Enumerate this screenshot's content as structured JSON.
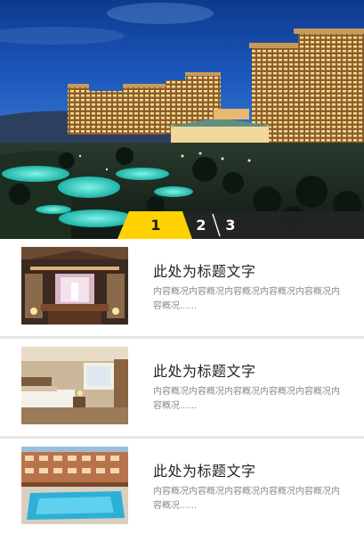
{
  "banner": {
    "slides": [
      "1",
      "2",
      "3"
    ],
    "active_slide": 1,
    "accent_color": "#ffd200"
  },
  "items": [
    {
      "title": "此处为标题文字",
      "description": "内容概况内容概况内容概况内容概况内容概况内容概况......",
      "thumbnail": "hotel-lounge-image"
    },
    {
      "title": "此处为标题文字",
      "description": "内容概况内容概况内容概况内容概况内容概况内容概况......",
      "thumbnail": "hotel-bedroom-image"
    },
    {
      "title": "此处为标题文字",
      "description": "内容概况内容概况内容概况内容概况内容概况内容概况......",
      "thumbnail": "hotel-pool-image"
    }
  ]
}
